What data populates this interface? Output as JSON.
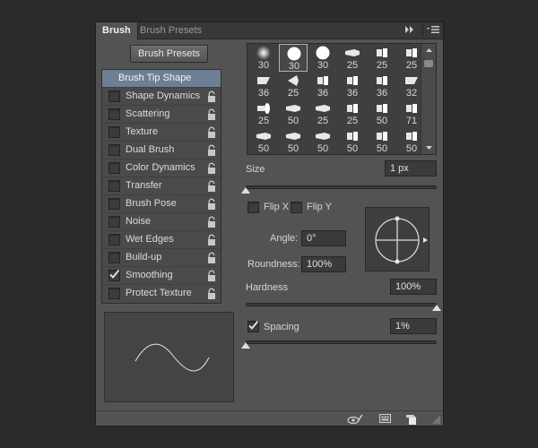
{
  "tabs": [
    {
      "label": "Brush",
      "active": true
    },
    {
      "label": "Brush Presets",
      "active": false
    }
  ],
  "header_controls": {
    "collapse_icon": "double-chevron-right-icon",
    "menu_icon": "panel-menu-icon"
  },
  "brush_presets_button": "Brush Presets",
  "options": [
    {
      "label": "Brush Tip Shape",
      "selected": true,
      "checkbox": false,
      "checked": false,
      "lock": false
    },
    {
      "label": "Shape Dynamics",
      "selected": false,
      "checkbox": true,
      "checked": false,
      "lock": true
    },
    {
      "label": "Scattering",
      "selected": false,
      "checkbox": true,
      "checked": false,
      "lock": true
    },
    {
      "label": "Texture",
      "selected": false,
      "checkbox": true,
      "checked": false,
      "lock": true
    },
    {
      "label": "Dual Brush",
      "selected": false,
      "checkbox": true,
      "checked": false,
      "lock": true
    },
    {
      "label": "Color Dynamics",
      "selected": false,
      "checkbox": true,
      "checked": false,
      "lock": true
    },
    {
      "label": "Transfer",
      "selected": false,
      "checkbox": true,
      "checked": false,
      "lock": true
    },
    {
      "label": "Brush Pose",
      "selected": false,
      "checkbox": true,
      "checked": false,
      "lock": true
    },
    {
      "label": "Noise",
      "selected": false,
      "checkbox": true,
      "checked": false,
      "lock": true
    },
    {
      "label": "Wet Edges",
      "selected": false,
      "checkbox": true,
      "checked": false,
      "lock": true
    },
    {
      "label": "Build-up",
      "selected": false,
      "checkbox": true,
      "checked": false,
      "lock": true
    },
    {
      "label": "Smoothing",
      "selected": false,
      "checkbox": true,
      "checked": true,
      "lock": true
    },
    {
      "label": "Protect Texture",
      "selected": false,
      "checkbox": true,
      "checked": false,
      "lock": true
    }
  ],
  "brush_tips": [
    {
      "size": "30",
      "shape": "soft-round",
      "selected": false
    },
    {
      "size": "30",
      "shape": "hard-round",
      "selected": true
    },
    {
      "size": "30",
      "shape": "hard-round",
      "selected": false
    },
    {
      "size": "25",
      "shape": "bristle-flat",
      "selected": false
    },
    {
      "size": "25",
      "shape": "bristle-flat",
      "selected": false
    },
    {
      "size": "25",
      "shape": "bristle-flat",
      "selected": false
    },
    {
      "size": "36",
      "shape": "bristle-angled",
      "selected": false
    },
    {
      "size": "25",
      "shape": "bristle-fan",
      "selected": false
    },
    {
      "size": "36",
      "shape": "bristle-flat",
      "selected": false
    },
    {
      "size": "36",
      "shape": "bristle-flat",
      "selected": false
    },
    {
      "size": "36",
      "shape": "bristle-flat",
      "selected": false
    },
    {
      "size": "32",
      "shape": "bristle-angled",
      "selected": false
    },
    {
      "size": "25",
      "shape": "bristle-side",
      "selected": false
    },
    {
      "size": "50",
      "shape": "bristle-flat",
      "selected": false
    },
    {
      "size": "25",
      "shape": "bristle-flat",
      "selected": false
    },
    {
      "size": "25",
      "shape": "bristle-flat",
      "selected": false
    },
    {
      "size": "50",
      "shape": "bristle-flat",
      "selected": false
    },
    {
      "size": "71",
      "shape": "bristle-flat",
      "selected": false
    },
    {
      "size": "50",
      "shape": "bristle-flat",
      "selected": false
    },
    {
      "size": "50",
      "shape": "bristle-flat",
      "selected": false
    },
    {
      "size": "50",
      "shape": "bristle-flat",
      "selected": false
    },
    {
      "size": "50",
      "shape": "bristle-flat",
      "selected": false
    },
    {
      "size": "50",
      "shape": "bristle-flat",
      "selected": false
    },
    {
      "size": "50",
      "shape": "bristle-flat",
      "selected": false
    }
  ],
  "size": {
    "label": "Size",
    "value": "1 px",
    "slider_fraction": 0.0
  },
  "flip_x": {
    "label": "Flip X",
    "checked": false
  },
  "flip_y": {
    "label": "Flip Y",
    "checked": false
  },
  "angle": {
    "label": "Angle:",
    "value": "0°"
  },
  "roundness": {
    "label": "Roundness:",
    "value": "100%"
  },
  "hardness": {
    "label": "Hardness",
    "value": "100%",
    "slider_fraction": 1.0
  },
  "spacing": {
    "label": "Spacing",
    "value": "1%",
    "checked": true,
    "slider_fraction": 0.0
  },
  "footer_icons": [
    "eye-brush-icon",
    "grid-toggle-icon",
    "new-preset-icon",
    "resize-grip-icon"
  ],
  "colors": {
    "panel": "#535353",
    "selection": "#6c7f95",
    "field": "#3a3a3a",
    "background": "#2b2b2b"
  }
}
